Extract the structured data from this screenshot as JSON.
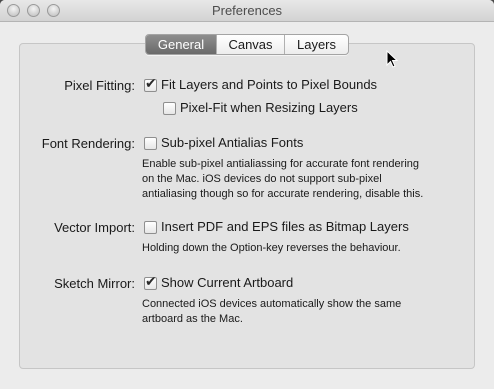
{
  "window": {
    "title": "Preferences"
  },
  "tabs": [
    {
      "label": "General",
      "active": true
    },
    {
      "label": "Canvas",
      "active": false
    },
    {
      "label": "Layers",
      "active": false
    }
  ],
  "settings": {
    "pixel_fitting": {
      "label": "Pixel Fitting:",
      "options": [
        {
          "label": "Fit Layers and Points to Pixel Bounds",
          "checked": true
        },
        {
          "label": "Pixel-Fit when Resizing Layers",
          "checked": false
        }
      ]
    },
    "font_rendering": {
      "label": "Font Rendering:",
      "option": {
        "label": "Sub-pixel Antialias Fonts",
        "checked": false
      },
      "description_lines": [
        "Enable sub-pixel antialiassing for accurate font rendering",
        "on the Mac. iOS devices do not support sub-pixel",
        "antialiasing though so for accurate rendering, disable this."
      ]
    },
    "vector_import": {
      "label": "Vector Import:",
      "option": {
        "label": "Insert PDF and EPS files as Bitmap Layers",
        "checked": false
      },
      "description_lines": [
        "Holding down the Option-key reverses the behaviour."
      ]
    },
    "sketch_mirror": {
      "label": "Sketch Mirror:",
      "option": {
        "label": "Show Current Artboard",
        "checked": true
      },
      "description_lines": [
        "Connected iOS devices automatically show the same",
        "artboard as the Mac."
      ]
    }
  }
}
